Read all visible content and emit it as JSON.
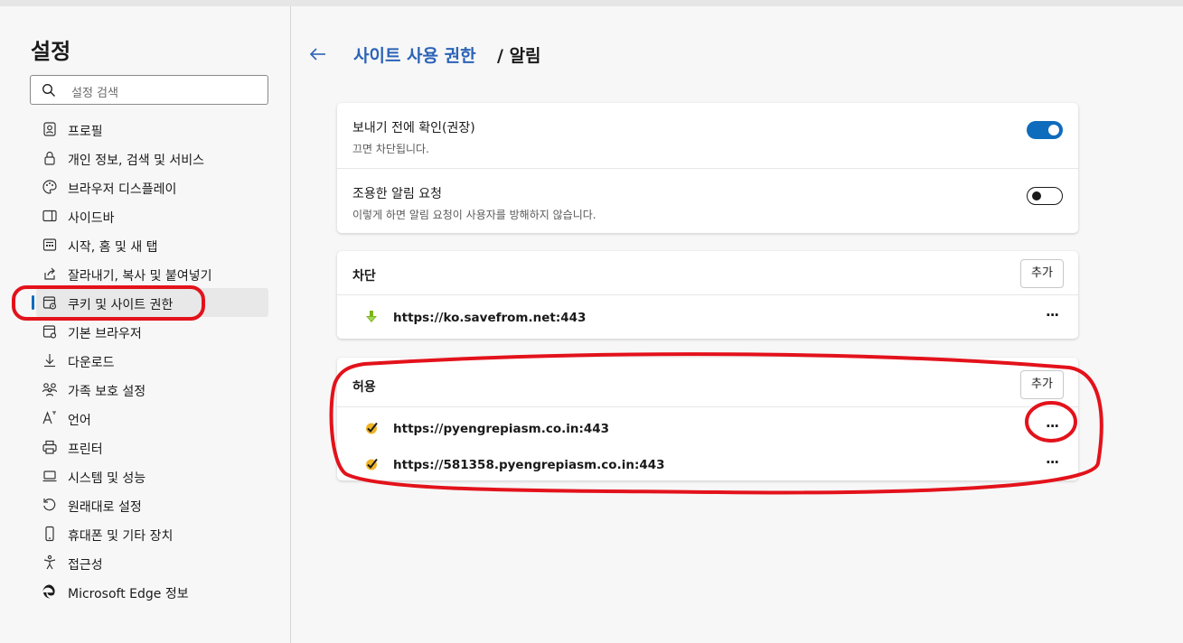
{
  "sidebar": {
    "title": "설정",
    "search_placeholder": "설정 검색",
    "items": [
      {
        "label": "프로필",
        "icon": "profile-icon"
      },
      {
        "label": "개인 정보, 검색 및 서비스",
        "icon": "lock-icon"
      },
      {
        "label": "브라우저 디스플레이",
        "icon": "palette-icon"
      },
      {
        "label": "사이드바",
        "icon": "sidebar-icon"
      },
      {
        "label": "시작, 홈 및 새 탭",
        "icon": "home-tab-icon"
      },
      {
        "label": "잘라내기, 복사 및 붙여넣기",
        "icon": "share-icon"
      },
      {
        "label": "쿠키 및 사이트 권한",
        "icon": "cookie-site-icon",
        "active": true
      },
      {
        "label": "기본 브라우저",
        "icon": "browser-icon"
      },
      {
        "label": "다운로드",
        "icon": "download-icon"
      },
      {
        "label": "가족 보호 설정",
        "icon": "family-icon"
      },
      {
        "label": "언어",
        "icon": "language-icon"
      },
      {
        "label": "프린터",
        "icon": "printer-icon"
      },
      {
        "label": "시스템 및 성능",
        "icon": "laptop-icon"
      },
      {
        "label": "원래대로 설정",
        "icon": "reset-icon"
      },
      {
        "label": "휴대폰 및 기타 장치",
        "icon": "phone-icon"
      },
      {
        "label": "접근성",
        "icon": "accessibility-icon"
      },
      {
        "label": "Microsoft Edge 정보",
        "icon": "edge-logo-icon"
      }
    ]
  },
  "breadcrumb": {
    "parent": "사이트 사용 권한",
    "separator": "/",
    "current": "알림"
  },
  "options": {
    "ask_before_send": {
      "title": "보내기 전에 확인(권장)",
      "subtitle": "끄면 차단됩니다.",
      "enabled": true
    },
    "quiet_requests": {
      "title": "조용한 알림 요청",
      "subtitle": "이렇게 하면 알림 요청이 사용자를 방해하지 않습니다.",
      "enabled": false
    }
  },
  "block": {
    "title": "차단",
    "add_label": "추가",
    "sites": [
      {
        "url": "https://ko.savefrom.net:443",
        "icon": "savefrom-download-icon"
      }
    ]
  },
  "allow": {
    "title": "허용",
    "add_label": "추가",
    "sites": [
      {
        "url": "https://pyengrepiasm.co.in:443",
        "icon": "check-badge-icon"
      },
      {
        "url": "https://581358.pyengrepiasm.co.in:443",
        "icon": "check-badge-icon"
      }
    ]
  },
  "more_label": "···",
  "colors": {
    "accent": "#0f6cbd",
    "link": "#2b63b6",
    "annotation": "#e3121b"
  }
}
